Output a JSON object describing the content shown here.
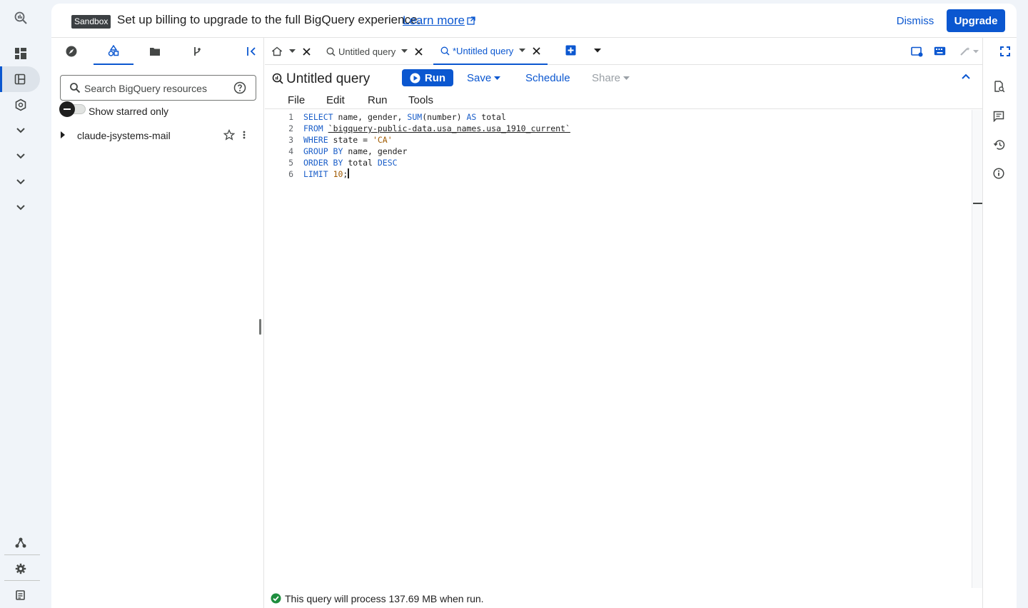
{
  "banner": {
    "badge": "Sandbox",
    "message": "Set up billing to upgrade to the full BigQuery experience.",
    "link": "Learn more",
    "dismiss": "Dismiss",
    "upgrade": "Upgrade"
  },
  "rail": {
    "icons": [
      "bigquery-search-icon",
      "dashboard-icon",
      "studio-icon",
      "pipeline-icon",
      "chevron-down-icon",
      "chevron-down-icon",
      "chevron-down-icon",
      "chevron-down-icon",
      "hub-icon",
      "settings-icon",
      "release-notes-icon"
    ]
  },
  "explorer": {
    "tabs": [
      "explore-icon",
      "resources-icon",
      "folder-icon",
      "repository-icon"
    ],
    "active_tab": 1,
    "search_placeholder": "Search BigQuery resources",
    "toggle_label": "Show starred only",
    "tree_items": [
      {
        "label": "claude-jsystems-mail"
      }
    ]
  },
  "tabs": [
    {
      "label": "Untitled query",
      "active": false
    },
    {
      "label": "*Untitled query",
      "active": true
    }
  ],
  "query": {
    "title": "Untitled query",
    "run": "Run",
    "save": "Save",
    "schedule": "Schedule",
    "share": "Share"
  },
  "menu": [
    "File",
    "Edit",
    "Run",
    "Tools"
  ],
  "editor": {
    "lines": [
      "SELECT name, gender, SUM(number) AS total",
      "FROM `bigquery-public-data.usa_names.usa_1910_current`",
      "WHERE state = 'CA'",
      "GROUP BY name, gender",
      "ORDER BY total DESC",
      "LIMIT 10;"
    ]
  },
  "status": {
    "message": "This query will process 137.69 MB when run."
  },
  "colors": {
    "accent": "#0b57d0",
    "success": "#1e8e3e",
    "keyword": "#1a5ec9",
    "literal": "#a05a00"
  }
}
